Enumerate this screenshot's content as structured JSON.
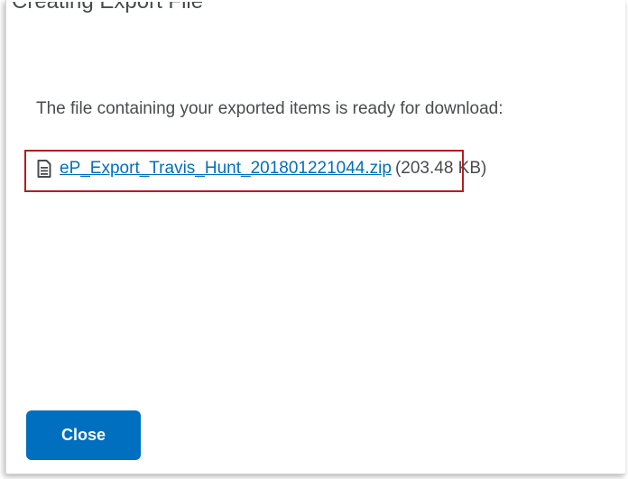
{
  "dialog": {
    "title": "Creating Export File",
    "message": "The file containing your exported items is ready for download:",
    "file": {
      "icon": "document-icon",
      "name": "eP_Export_Travis_Hunt_201801221044.zip",
      "size": "(203.48 KB)"
    },
    "close_label": "Close"
  },
  "colors": {
    "link": "#006fbf",
    "primary_button": "#006fbf",
    "text": "#494c4e",
    "highlight": "#b71c1c"
  }
}
